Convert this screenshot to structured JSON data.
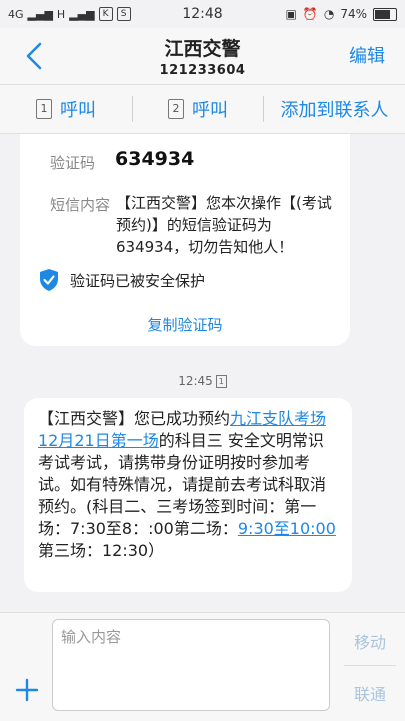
{
  "status_bar": {
    "network": "4G",
    "network2": "H",
    "time": "12:48",
    "battery": "74%"
  },
  "header": {
    "title": "江西交警",
    "number": "121233604",
    "edit_label": "编辑"
  },
  "actions": {
    "call1_label": "呼叫",
    "call1_sim": "1",
    "call2_label": "呼叫",
    "call2_sim": "2",
    "add_contact_label": "添加到联系人"
  },
  "verification_card": {
    "code_label": "验证码",
    "code_value": "634934",
    "content_label": "短信内容",
    "content_text": "【江西交警】您本次操作【(考试预约)】的短信验证码为634934，切勿告知他人！",
    "protection_text": "验证码已被安全保护",
    "copy_label": "复制验证码"
  },
  "message": {
    "time": "12:45",
    "sim": "1",
    "part1": "【江西交警】您已成功预约",
    "link1": "九江支队考场12月21日第一场",
    "part2": "的科目三 安全文明常识考试考试，请携带身份证明按时参加考试。如有特殊情况，请提前去考试科取消预约。(科目二、三考场签到时间：第一场：7:30至8：:00第二场：",
    "link2": "9:30至10:00",
    "part3": "第三场：12:30）"
  },
  "composer": {
    "placeholder": "输入内容",
    "send_carrier1": "移动",
    "send_carrier2": "联通"
  },
  "colors": {
    "accent": "#1e88e5",
    "background": "#f2f2f4",
    "shield": "#1e88e5"
  }
}
